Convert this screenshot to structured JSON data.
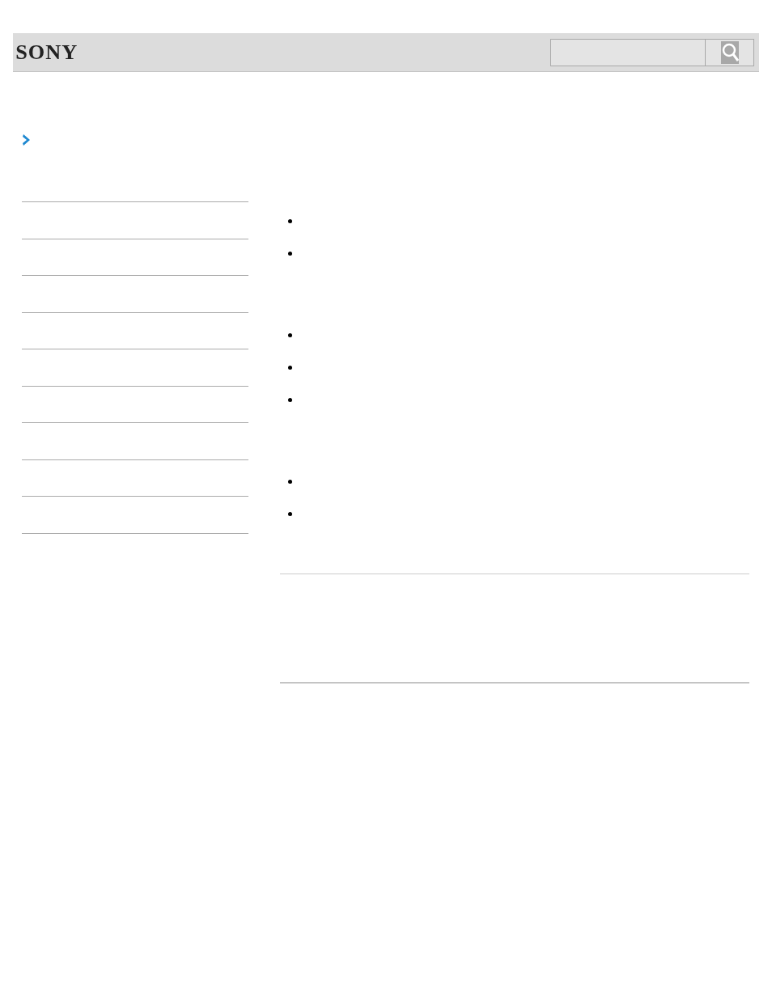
{
  "header": {
    "logo": "SONY",
    "search": {
      "kind": "search"
    }
  },
  "sidebar": {
    "items": [
      {
        "kind": "entry"
      },
      {
        "kind": "entry"
      },
      {
        "kind": "entry"
      },
      {
        "kind": "entry"
      },
      {
        "kind": "entry"
      },
      {
        "kind": "entry"
      },
      {
        "kind": "entry"
      },
      {
        "kind": "entry"
      },
      {
        "kind": "entry"
      }
    ]
  },
  "content": {
    "groups": [
      [
        {
          "kind": "bullet"
        },
        {
          "kind": "bullet"
        }
      ],
      [
        {
          "kind": "bullet"
        },
        {
          "kind": "bullet"
        },
        {
          "kind": "bullet"
        }
      ],
      [
        {
          "kind": "bullet"
        },
        {
          "kind": "bullet"
        }
      ]
    ]
  }
}
